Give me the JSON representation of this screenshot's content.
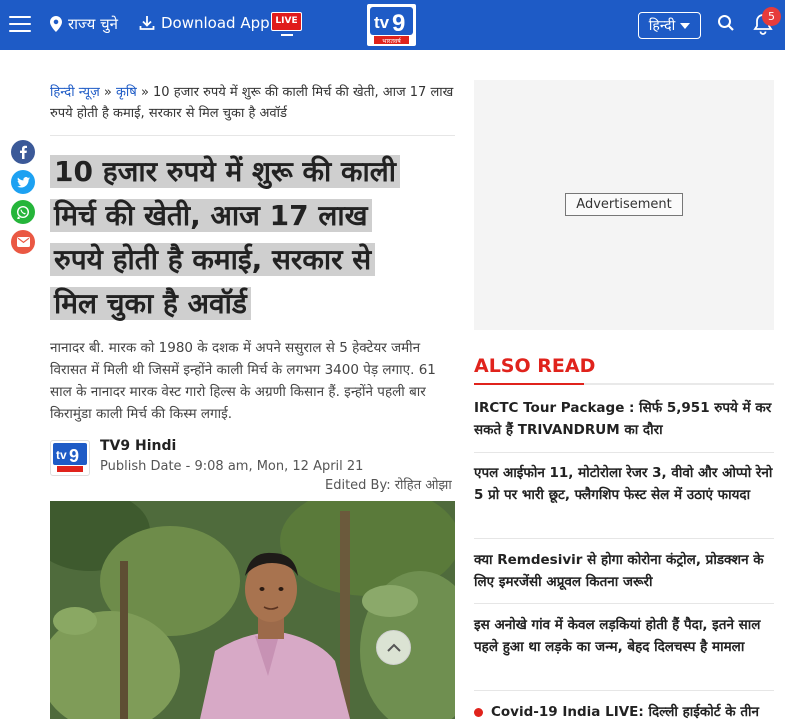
{
  "header": {
    "location_label": "राज्य चुने",
    "download_label": "Download App",
    "live_label": "LIVE",
    "logo_text": "tv9",
    "logo_subtext": "भारतवर्ष",
    "language": "हिन्दी",
    "notification_count": "5",
    "brand_color": "#1e5bc6"
  },
  "breadcrumb": {
    "home": "हिन्दी न्यूज़",
    "sep1": " » ",
    "category": "कृषि",
    "sep2": " » ",
    "current": "10 हजार रुपये में शुरू की काली मिर्च की खेती, आज 17 लाख रुपये होती है कमाई, सरकार से मिल चुका है अवॉर्ड"
  },
  "article": {
    "title_lines": [
      "10 हजार रुपये में शुरू की काली",
      "मिर्च की खेती, आज 17 लाख",
      "रुपये होती है कमाई, सरकार से",
      "मिल चुका है अवॉर्ड"
    ],
    "summary": "नानादर बी. मारक को 1980 के दशक में अपने ससुराल से 5 हेक्टेयर जमीन विरासत में मिली थी जिसमें इन्होंने काली मिर्च के लगभग 3400 पेड़ लगाए. 61 साल के नानादर मारक वेस्ट गारो हिल्स के अग्रणी किसान हैं. इन्होंने पहली बार किरामुंडा काली मिर्च की किस्म लगाई.",
    "author": "TV9 Hindi",
    "publish_date": "Publish Date - 9:08 am, Mon, 12 April 21",
    "edited_by": "Edited By: रोहित ओझा"
  },
  "share": [
    "facebook-icon",
    "twitter-icon",
    "whatsapp-icon",
    "mail-icon"
  ],
  "sidebar": {
    "ad_label": "Advertisement",
    "also_read_title": "ALSO READ",
    "accent_color": "#e0231c",
    "items": [
      "IRCTC Tour Package : सिर्फ 5,951 रुपये में कर सकते हैं TRIVANDRUM का दौरा",
      "एपल आईफोन 11, मोटोरोला रेजर 3, वीवो और ओप्पो रेनो 5 प्रो पर भारी छूट, फ्लैगशिप फेस्ट सेल में उठाएं फायदा",
      "क्या Remdesivir से होगा कोरोना कंट्रोल, प्रोडक्शन के लिए इमरजेंसी अप्रूवल कितना जरूरी",
      "इस अनोखे गांव में केवल लड़कियां होती हैं पैदा, इतने साल पहले हुआ था लड़के का जन्म, बेहद दिलचस्प है मामला",
      "Covid-19 India LIVE: दिल्ली हाईकोर्ट के तीन"
    ]
  }
}
